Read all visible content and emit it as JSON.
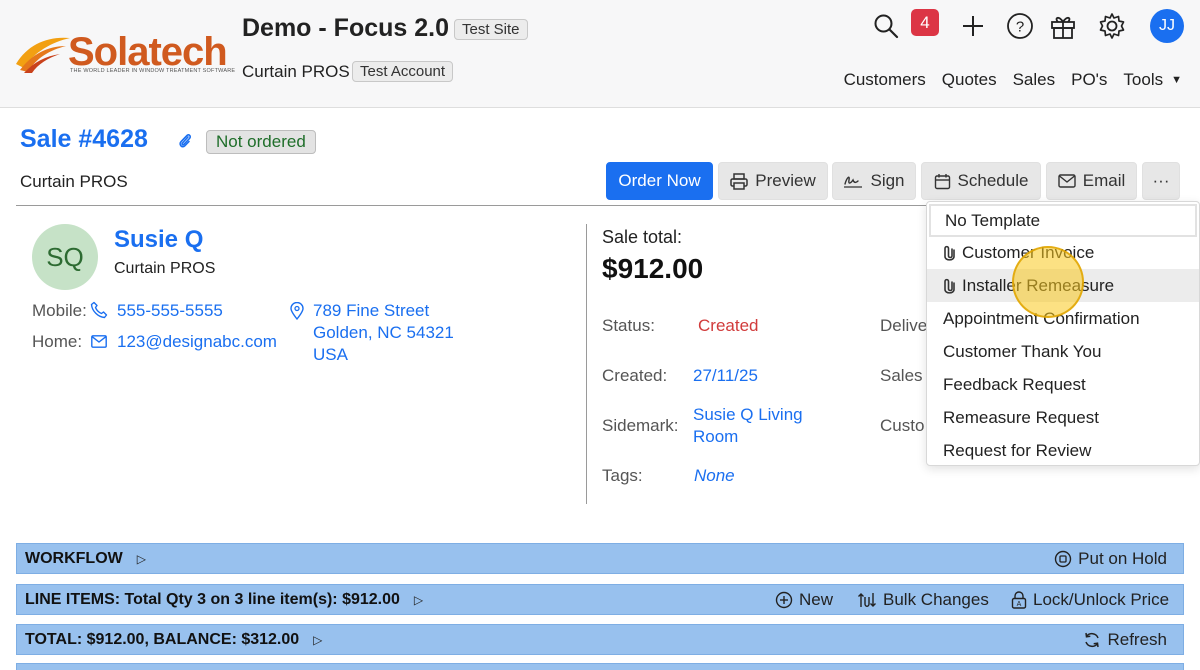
{
  "header": {
    "logo_text": "Solatech",
    "logo_tagline": "THE WORLD LEADER IN WINDOW TREATMENT SOFTWARE",
    "app_title": "Demo - Focus 2.0",
    "site_badge": "Test Site",
    "account_name": "Curtain PROS",
    "account_badge": "Test Account",
    "notification_count": "4",
    "user_initials": "JJ",
    "icons": [
      "search-icon",
      "bell-icon",
      "plus-icon",
      "help-icon",
      "gift-icon",
      "gear-icon"
    ],
    "nav": [
      "Customers",
      "Quotes",
      "Sales",
      "PO's",
      "Tools"
    ]
  },
  "sale": {
    "title": "Sale #4628",
    "status_badge": "Not ordered",
    "company": "Curtain PROS"
  },
  "actions": {
    "order_now": "Order Now",
    "preview": "Preview",
    "sign": "Sign",
    "schedule": "Schedule",
    "email": "Email",
    "more": "···"
  },
  "customer": {
    "initials": "SQ",
    "name": "Susie Q",
    "company": "Curtain PROS",
    "mobile_label": "Mobile:",
    "mobile": "555-555-5555",
    "home_label": "Home:",
    "email": "123@designabc.com",
    "address_line1": "789 Fine Street",
    "address_line2": "Golden, NC 54321",
    "address_line3": "USA"
  },
  "summary": {
    "total_label": "Sale total:",
    "total_value": "$912.00",
    "status_label": "Status:",
    "status_value": "Created",
    "created_label": "Created:",
    "created_value": "27/11/25",
    "sidemark_label": "Sidemark:",
    "sidemark_line1": "Susie Q Living",
    "sidemark_line2": "Room",
    "tags_label": "Tags:",
    "tags_value": "None",
    "right_labels": [
      "Delive",
      "Sales",
      "Custo"
    ]
  },
  "email_menu": {
    "items": [
      {
        "label": "No Template",
        "icon": ""
      },
      {
        "label": "Customer Invoice",
        "icon": "paperclip-icon"
      },
      {
        "label": "Installer Remeasure",
        "icon": "paperclip-icon"
      },
      {
        "label": "Appointment Confirmation",
        "icon": ""
      },
      {
        "label": "Customer Thank You",
        "icon": ""
      },
      {
        "label": "Feedback Request",
        "icon": ""
      },
      {
        "label": "Remeasure Request",
        "icon": ""
      },
      {
        "label": "Request for Review",
        "icon": ""
      }
    ]
  },
  "sections": {
    "workflow": {
      "title": "WORKFLOW",
      "action": "Put on Hold"
    },
    "line_items": {
      "title": "LINE ITEMS: Total Qty 3 on 3 line item(s): $912.00",
      "new": "New",
      "bulk": "Bulk Changes",
      "lock": "Lock/Unlock Price"
    },
    "total": {
      "title": "TOTAL: $912.00, BALANCE: $312.00",
      "refresh": "Refresh"
    }
  },
  "colors": {
    "accent": "#1a6ff0",
    "section_bar": "#98c1ee",
    "status_red": "#d13b3b",
    "status_green": "#1f6e2a",
    "badge_red": "#dc3545",
    "logo_orange": "#d05a1f"
  }
}
